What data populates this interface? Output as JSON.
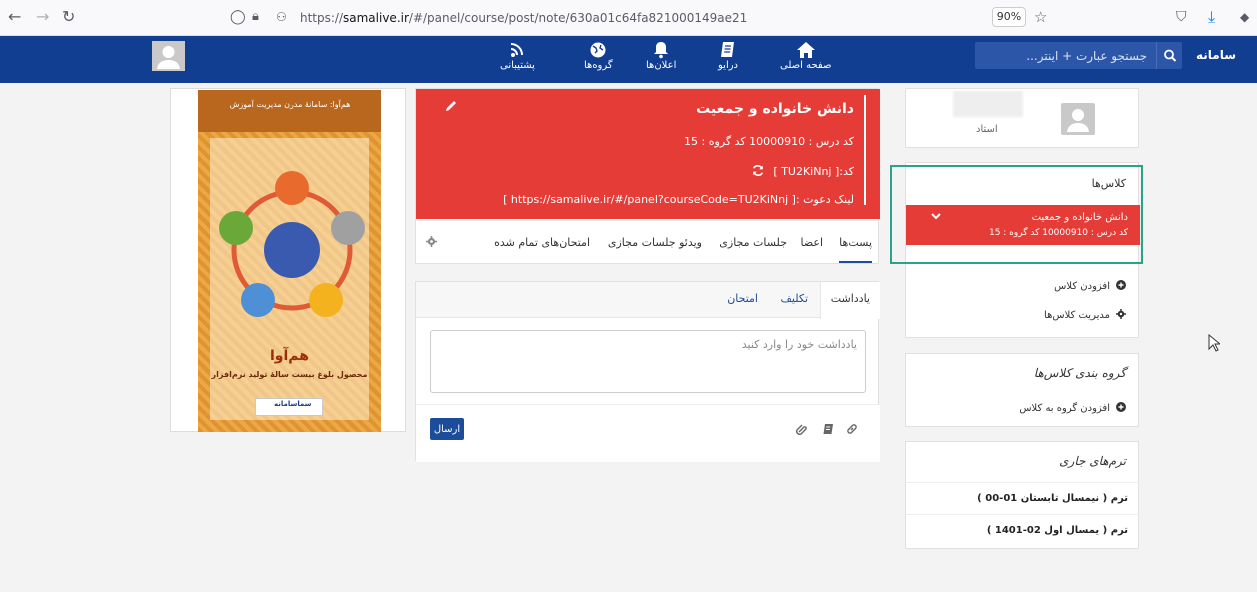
{
  "browser": {
    "url_prefix": "https://",
    "url_domain": "samalive.ir",
    "url_path": "/#/panel/course/post/note/630a01c64fa821000149ae21",
    "zoom": "90%"
  },
  "topnav": {
    "search_placeholder": "جستجو عبارت + اینتر...",
    "brand": "سامانه",
    "items": [
      {
        "label": "صفحه اصلی",
        "icon": "home-icon"
      },
      {
        "label": "درایو",
        "icon": "drive-icon"
      },
      {
        "label": "اعلان‌ها",
        "icon": "bell-icon"
      },
      {
        "label": "گروه‌ها",
        "icon": "globe-icon"
      },
      {
        "label": "پشتیبانی",
        "icon": "rss-icon"
      }
    ]
  },
  "poster": {
    "top_text": "هم‌آوا: سامانهٔ مدرن مدیریت آموزش",
    "title": "هم‌آوا",
    "subtitle": "محصول بلوغ بیست سالهٔ تولید نرم‌افزار",
    "logo": "سماسامانه"
  },
  "course": {
    "title": "دانش خانواده و جمعیت",
    "code_line": "کد درس : 10000910   کد گروه : 15",
    "invite_code": "کد:[ TU2KiNnj ]",
    "invite_link": "لینک دعوت :[ https://samalive.ir/#/panel?courseCode=TU2KiNnj ]",
    "tabs": [
      "پست‌ها",
      "اعضا",
      "جلسات مجازی",
      "ویدئو جلسات مجازی",
      "امتحان‌های تمام شده"
    ]
  },
  "post": {
    "tabs": [
      "یادداشت",
      "تکلیف",
      "امتحان"
    ],
    "placeholder": "یادداشت خود را وارد کنید",
    "send": "ارسال"
  },
  "sidebar": {
    "teacher_role": "استاد",
    "classes_title": "کلاس‌ها",
    "class_item": {
      "title": "دانش خانواده و جمعیت",
      "sub": "کد درس : 10000910   کد گروه : 15"
    },
    "add_class": "افزودن کلاس",
    "manage_classes": "مدیریت کلاس‌ها",
    "group_title": "گروه بندی کلاس‌ها",
    "add_group": "افزودن گروه به کلاس",
    "terms_title": "ترم‌های جاری",
    "terms": [
      "ترم ( نیمسال تابستان 01-00 )",
      "ترم ( یمسال اول 02-1401 )"
    ]
  },
  "colors": {
    "nav": "#123e91",
    "accent_red": "#e53c37",
    "primary_blue": "#1b4d9b",
    "highlight": "#2aa389"
  }
}
